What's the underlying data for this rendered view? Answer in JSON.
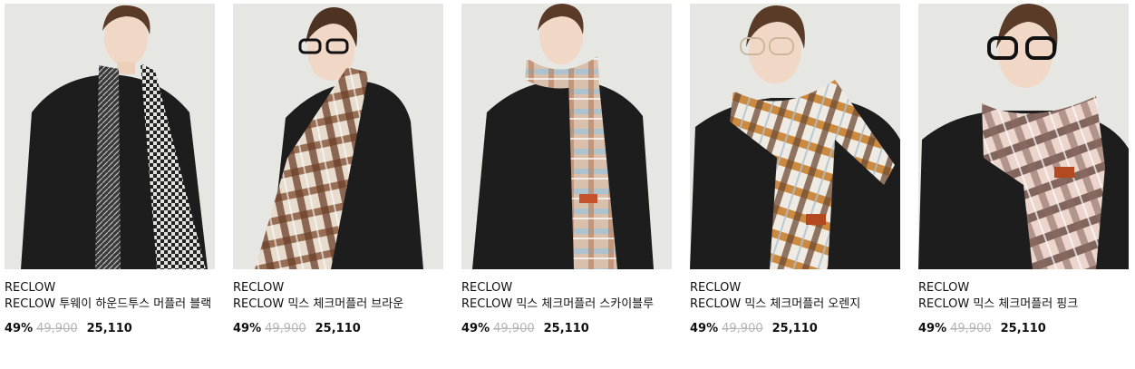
{
  "products": [
    {
      "brand": "RECLOW",
      "title": "RECLOW 투웨이 하운드투스 머플러 블랙",
      "discount": "49%",
      "original_price": "49,900",
      "sale_price": "25,110",
      "image_icon": "houndstooth-scarf-black-photo",
      "colors": {
        "scarf_a": "#2b2b2b",
        "scarf_b": "#d9d9d4",
        "coat": "#1c1c1c"
      }
    },
    {
      "brand": "RECLOW",
      "title": "RECLOW 믹스 체크머플러 브라운",
      "discount": "49%",
      "original_price": "49,900",
      "sale_price": "25,110",
      "image_icon": "check-scarf-brown-photo",
      "colors": {
        "scarf_a": "#7a4a32",
        "scarf_b": "#e8dccd",
        "coat": "#1c1c1c"
      }
    },
    {
      "brand": "RECLOW",
      "title": "RECLOW 믹스 체크머플러 스카이블루",
      "discount": "49%",
      "original_price": "49,900",
      "sale_price": "25,110",
      "image_icon": "check-scarf-skyblue-photo",
      "colors": {
        "scarf_a": "#c79a7b",
        "scarf_b": "#a9c4d3",
        "coat": "#1c1c1c"
      }
    },
    {
      "brand": "RECLOW",
      "title": "RECLOW 믹스 체크머플러 오렌지",
      "discount": "49%",
      "original_price": "49,900",
      "sale_price": "25,110",
      "image_icon": "check-scarf-orange-photo",
      "colors": {
        "scarf_a": "#c47a2c",
        "scarf_b": "#ece7df",
        "coat": "#1c1c1c"
      }
    },
    {
      "brand": "RECLOW",
      "title": "RECLOW 믹스 체크머플러 핑크",
      "discount": "49%",
      "original_price": "49,900",
      "sale_price": "25,110",
      "image_icon": "check-scarf-pink-photo",
      "colors": {
        "scarf_a": "#6e4e48",
        "scarf_b": "#e9cfc6",
        "coat": "#1c1c1c"
      }
    }
  ]
}
